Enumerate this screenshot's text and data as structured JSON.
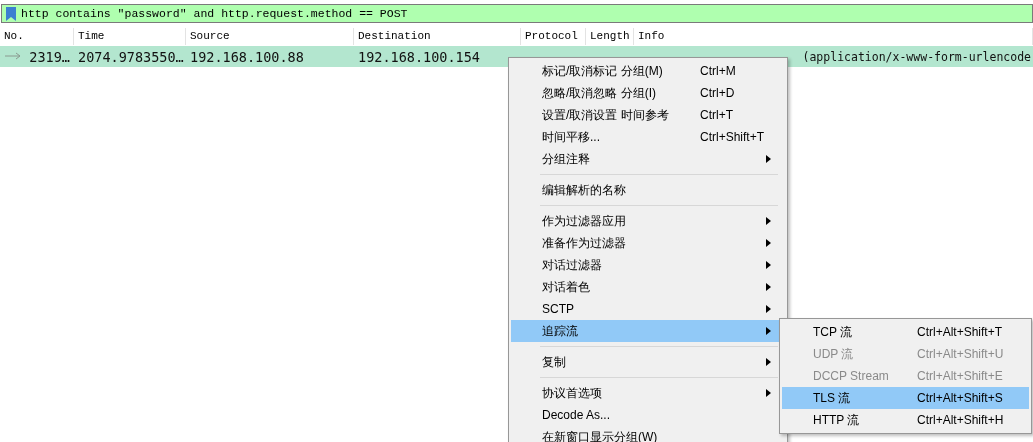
{
  "filter": {
    "text": "http contains \"password\" and http.request.method == POST"
  },
  "table": {
    "columns": [
      "No.",
      "Time",
      "Source",
      "Destination",
      "Protocol",
      "Length",
      "Info"
    ],
    "rows": [
      {
        "cells": [
          "2319…",
          "2074.9783550…",
          "192.168.100.88",
          "192.168.100.154"
        ],
        "info_visible": "(application/x-www-form-urlencode"
      }
    ]
  },
  "context_menu": {
    "items": [
      {
        "kind": "item",
        "label": "标记/取消标记 分组(M)",
        "shortcut": "Ctrl+M",
        "submenu": false,
        "selected": false
      },
      {
        "kind": "item",
        "label": "忽略/取消忽略 分组(I)",
        "shortcut": "Ctrl+D",
        "submenu": false,
        "selected": false
      },
      {
        "kind": "item",
        "label": "设置/取消设置 时间参考",
        "shortcut": "Ctrl+T",
        "submenu": false,
        "selected": false
      },
      {
        "kind": "item",
        "label": "时间平移...",
        "shortcut": "Ctrl+Shift+T",
        "submenu": false,
        "selected": false
      },
      {
        "kind": "item",
        "label": "分组注释",
        "submenu": true,
        "selected": false
      },
      {
        "kind": "separator"
      },
      {
        "kind": "item",
        "label": "编辑解析的名称",
        "submenu": false,
        "selected": false
      },
      {
        "kind": "separator"
      },
      {
        "kind": "item",
        "label": "作为过滤器应用",
        "submenu": true,
        "selected": false
      },
      {
        "kind": "item",
        "label": "准备作为过滤器",
        "submenu": true,
        "selected": false
      },
      {
        "kind": "item",
        "label": "对话过滤器",
        "submenu": true,
        "selected": false
      },
      {
        "kind": "item",
        "label": "对话着色",
        "submenu": true,
        "selected": false
      },
      {
        "kind": "item",
        "label": "SCTP",
        "submenu": true,
        "selected": false
      },
      {
        "kind": "item",
        "label": "追踪流",
        "submenu": true,
        "selected": true
      },
      {
        "kind": "separator"
      },
      {
        "kind": "item",
        "label": "复制",
        "submenu": true,
        "selected": false
      },
      {
        "kind": "separator"
      },
      {
        "kind": "item",
        "label": "协议首选项",
        "submenu": true,
        "selected": false
      },
      {
        "kind": "item",
        "label": "Decode As...",
        "submenu": false,
        "selected": false
      },
      {
        "kind": "item",
        "label": "在新窗口显示分组(W)",
        "submenu": false,
        "selected": false
      }
    ]
  },
  "submenu": {
    "items": [
      {
        "label": "TCP 流",
        "shortcut": "Ctrl+Alt+Shift+T",
        "disabled": false,
        "selected": false
      },
      {
        "label": "UDP 流",
        "shortcut": "Ctrl+Alt+Shift+U",
        "disabled": true,
        "selected": false
      },
      {
        "label": "DCCP Stream",
        "shortcut": "Ctrl+Alt+Shift+E",
        "disabled": true,
        "selected": false
      },
      {
        "label": "TLS 流",
        "shortcut": "Ctrl+Alt+Shift+S",
        "disabled": false,
        "selected": true
      },
      {
        "label": "HTTP 流",
        "shortcut": "Ctrl+Alt+Shift+H",
        "disabled": false,
        "selected": false
      }
    ]
  }
}
